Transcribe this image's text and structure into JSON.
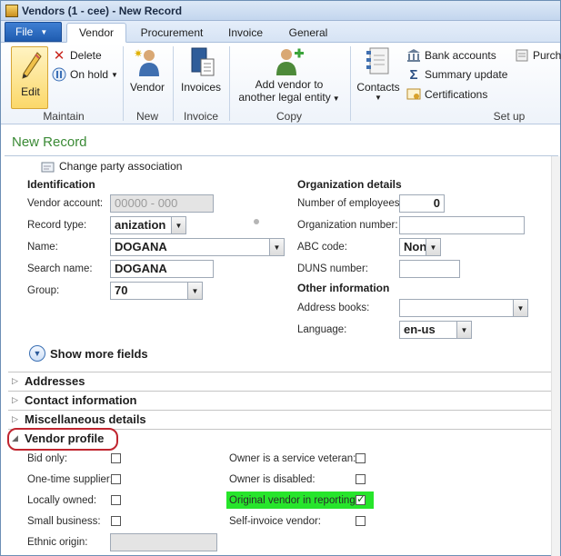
{
  "window": {
    "title": "Vendors (1 - cee) - New Record"
  },
  "tabs": [
    "File",
    "Vendor",
    "Procurement",
    "Invoice",
    "General"
  ],
  "active_tab": "Vendor",
  "ribbon": {
    "maintain": {
      "edit": "Edit",
      "delete": "Delete",
      "on_hold": "On hold",
      "label": "Maintain"
    },
    "new": {
      "vendor": "Vendor",
      "label": "New"
    },
    "invoice": {
      "invoices": "Invoices",
      "label": "Invoice"
    },
    "copy": {
      "add_line1": "Add vendor to",
      "add_line2": "another legal entity",
      "label": "Copy"
    },
    "setup": {
      "contacts": "Contacts",
      "bank_accounts": "Bank accounts",
      "summary_update": "Summary update",
      "certifications": "Certifications",
      "purch": "Purcha",
      "label": "Set up"
    }
  },
  "record_title": "New Record",
  "change_party": "Change party association",
  "identification": {
    "heading": "Identification",
    "vendor_account_label": "Vendor account:",
    "vendor_account_value": "00000 - 000",
    "record_type_label": "Record type:",
    "record_type_value": "anization",
    "name_label": "Name:",
    "name_value": "DOGANA",
    "search_name_label": "Search name:",
    "search_name_value": "DOGANA",
    "group_label": "Group:",
    "group_value": "70"
  },
  "organization": {
    "heading": "Organization details",
    "employees_label": "Number of employees:",
    "employees_value": "0",
    "org_number_label": "Organization number:",
    "org_number_value": "",
    "abc_label": "ABC code:",
    "abc_value": "Non",
    "duns_label": "DUNS number:",
    "duns_value": ""
  },
  "other": {
    "heading": "Other information",
    "address_books_label": "Address books:",
    "address_books_value": "",
    "language_label": "Language:",
    "language_value": "en-us"
  },
  "show_more": "Show more fields",
  "fasttabs": [
    "Addresses",
    "Contact information",
    "Miscellaneous details",
    "Vendor profile"
  ],
  "vendor_profile": {
    "left": [
      {
        "label": "Bid only:",
        "checked": false
      },
      {
        "label": "One-time supplier:",
        "checked": false
      },
      {
        "label": "Locally owned:",
        "checked": false
      },
      {
        "label": "Small business:",
        "checked": false
      }
    ],
    "ethnic_label": "Ethnic origin:",
    "ethnic_value": "",
    "right": [
      {
        "label": "Owner is a service veteran:",
        "checked": false
      },
      {
        "label": "Owner is disabled:",
        "checked": false
      },
      {
        "label": "Original vendor in reporting:",
        "checked": true
      },
      {
        "label": "Self-invoice vendor:",
        "checked": false
      }
    ]
  },
  "colors": {
    "accent_blue": "#1f5cb0",
    "title_green": "#3a8a35",
    "highlight_green": "#27e52b",
    "oval_red": "#c0252f"
  }
}
